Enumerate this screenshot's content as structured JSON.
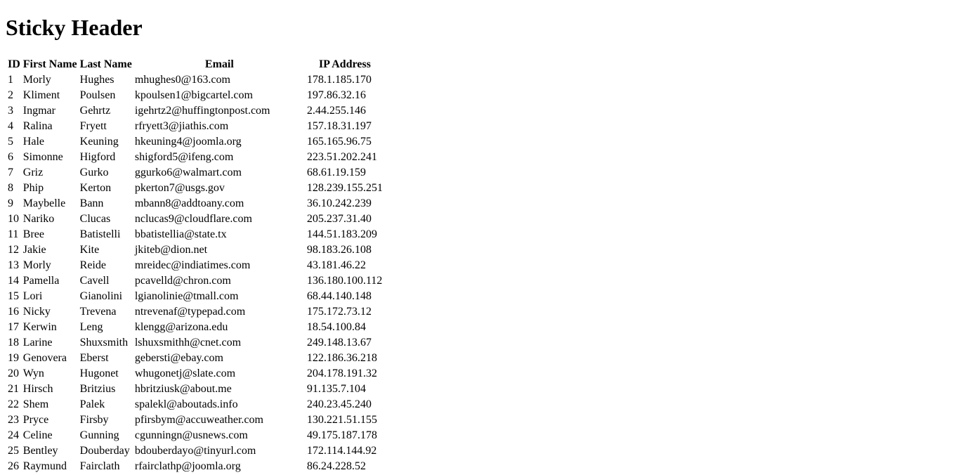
{
  "page": {
    "title": "Sticky Header"
  },
  "table": {
    "columns": [
      "ID",
      "First Name",
      "Last Name",
      "Email",
      "IP Address"
    ],
    "rows": [
      [
        "1",
        "Morly",
        "Hughes",
        "mhughes0@163.com",
        "178.1.185.170"
      ],
      [
        "2",
        "Kliment",
        "Poulsen",
        "kpoulsen1@bigcartel.com",
        "197.86.32.16"
      ],
      [
        "3",
        "Ingmar",
        "Gehrtz",
        "igehrtz2@huffingtonpost.com",
        "2.44.255.146"
      ],
      [
        "4",
        "Ralina",
        "Fryett",
        "rfryett3@jiathis.com",
        "157.18.31.197"
      ],
      [
        "5",
        "Hale",
        "Keuning",
        "hkeuning4@joomla.org",
        "165.165.96.75"
      ],
      [
        "6",
        "Simonne",
        "Higford",
        "shigford5@ifeng.com",
        "223.51.202.241"
      ],
      [
        "7",
        "Griz",
        "Gurko",
        "ggurko6@walmart.com",
        "68.61.19.159"
      ],
      [
        "8",
        "Phip",
        "Kerton",
        "pkerton7@usgs.gov",
        "128.239.155.251"
      ],
      [
        "9",
        "Maybelle",
        "Bann",
        "mbann8@addtoany.com",
        "36.10.242.239"
      ],
      [
        "10",
        "Nariko",
        "Clucas",
        "nclucas9@cloudflare.com",
        "205.237.31.40"
      ],
      [
        "11",
        "Bree",
        "Batistelli",
        "bbatistellia@state.tx",
        "144.51.183.209"
      ],
      [
        "12",
        "Jakie",
        "Kite",
        "jkiteb@dion.net",
        "98.183.26.108"
      ],
      [
        "13",
        "Morly",
        "Reide",
        "mreidec@indiatimes.com",
        "43.181.46.22"
      ],
      [
        "14",
        "Pamella",
        "Cavell",
        "pcavelld@chron.com",
        "136.180.100.112"
      ],
      [
        "15",
        "Lori",
        "Gianolini",
        "lgianolinie@tmall.com",
        "68.44.140.148"
      ],
      [
        "16",
        "Nicky",
        "Trevena",
        "ntrevenaf@typepad.com",
        "175.172.73.12"
      ],
      [
        "17",
        "Kerwin",
        "Leng",
        "klengg@arizona.edu",
        "18.54.100.84"
      ],
      [
        "18",
        "Larine",
        "Shuxsmith",
        "lshuxsmithh@cnet.com",
        "249.148.13.67"
      ],
      [
        "19",
        "Genovera",
        "Eberst",
        "gebersti@ebay.com",
        "122.186.36.218"
      ],
      [
        "20",
        "Wyn",
        "Hugonet",
        "whugonetj@slate.com",
        "204.178.191.32"
      ],
      [
        "21",
        "Hirsch",
        "Britzius",
        "hbritziusk@about.me",
        "91.135.7.104"
      ],
      [
        "22",
        "Shem",
        "Palek",
        "spalekl@aboutads.info",
        "240.23.45.240"
      ],
      [
        "23",
        "Pryce",
        "Firsby",
        "pfirsbym@accuweather.com",
        "130.221.51.155"
      ],
      [
        "24",
        "Celine",
        "Gunning",
        "cgunningn@usnews.com",
        "49.175.187.178"
      ],
      [
        "25",
        "Bentley",
        "Douberday",
        "bdouberdayo@tinyurl.com",
        "172.114.144.92"
      ],
      [
        "26",
        "Raymund",
        "Fairclath",
        "rfairclathp@joomla.org",
        "86.24.228.52"
      ]
    ]
  }
}
